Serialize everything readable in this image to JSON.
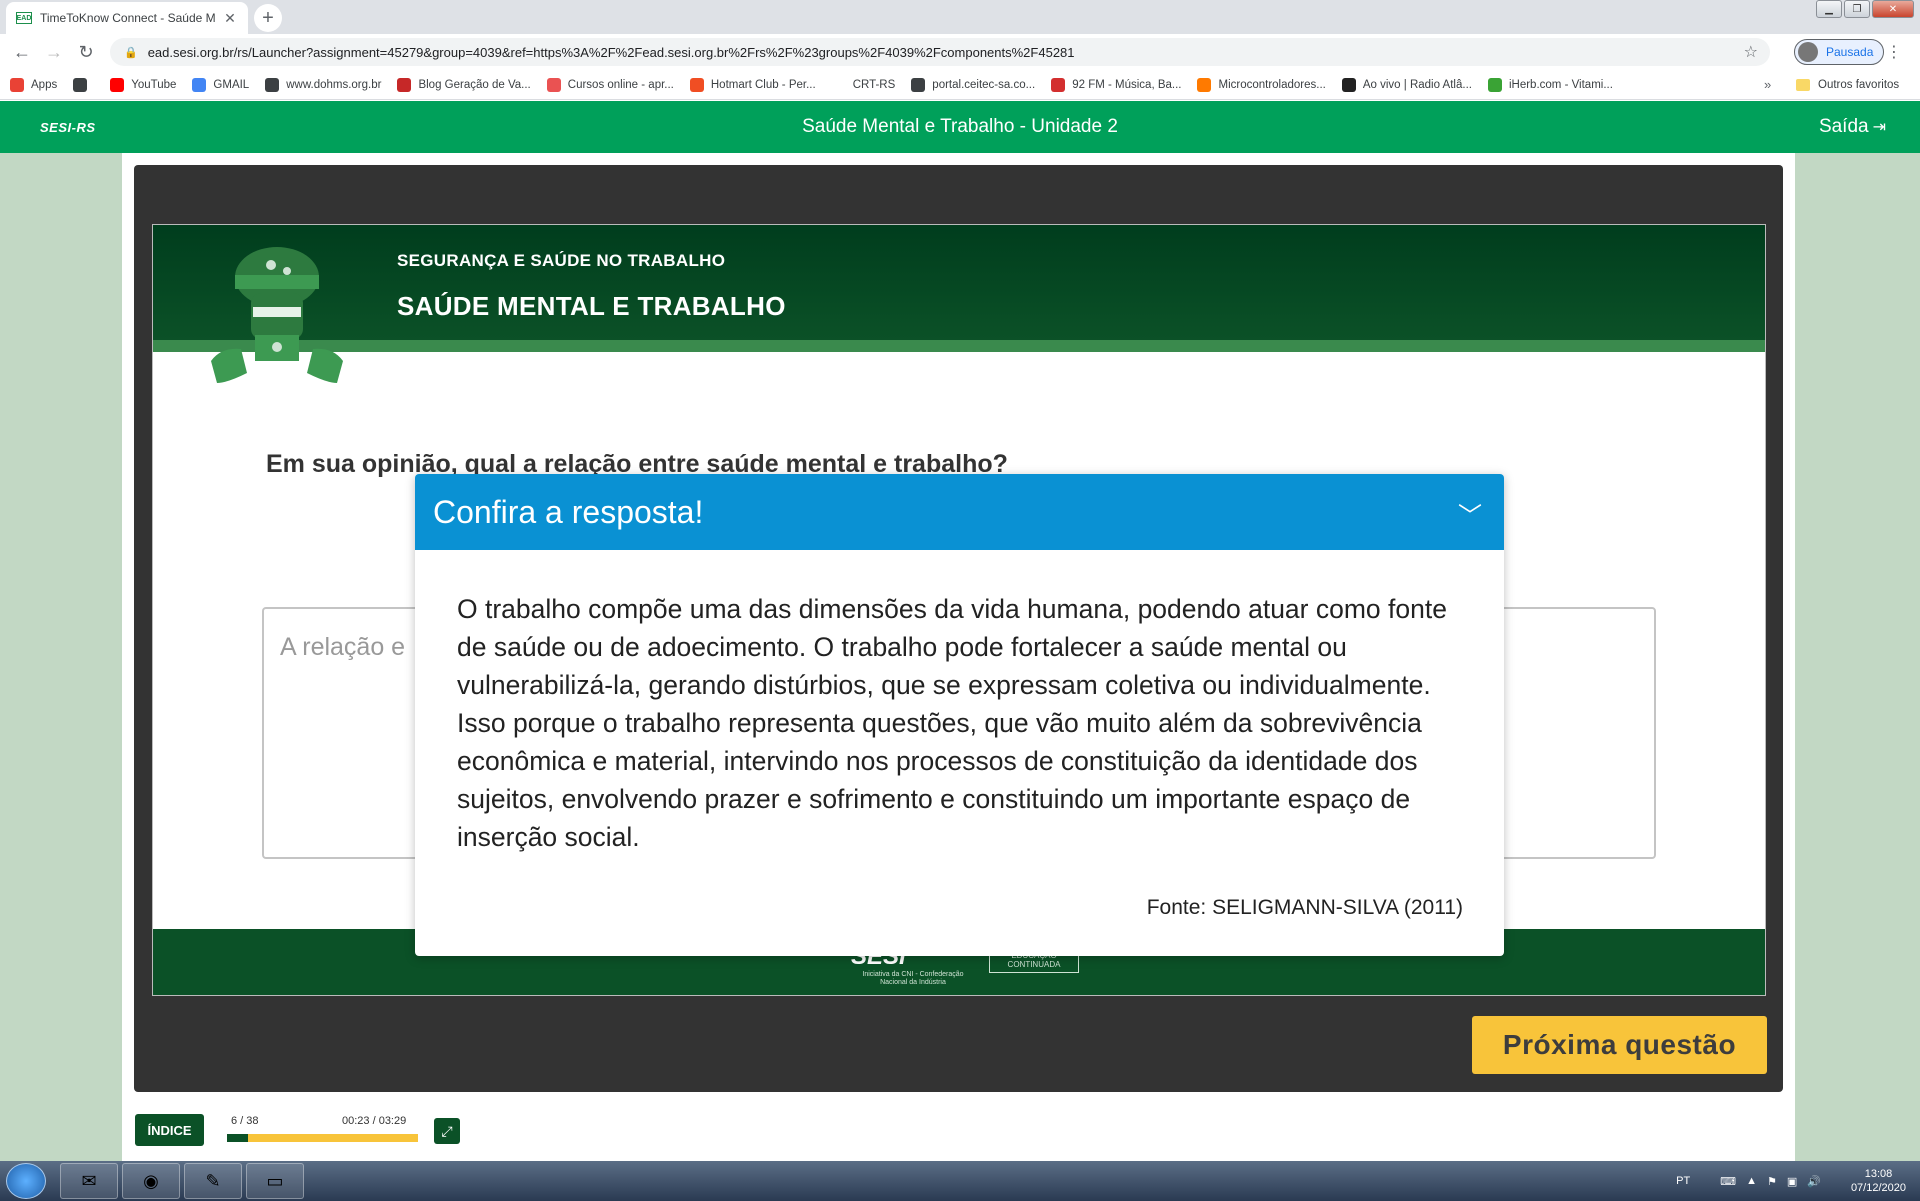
{
  "browser": {
    "tab_title": "TimeToKnow Connect - Saúde M",
    "tab_favicon": "EAD",
    "url": "ead.sesi.org.br/rs/Launcher?assignment=45279&group=4039&ref=https%3A%2F%2Fead.sesi.org.br%2Frs%2F%23groups%2F4039%2Fcomponents%2F45281",
    "profile_label": "Pausada",
    "bookmarks": [
      {
        "label": "Apps",
        "icon": "apps-grid-icon",
        "color": "#e94235"
      },
      {
        "label": "",
        "icon": "globe-icon",
        "color": "#3c4043"
      },
      {
        "label": "YouTube",
        "icon": "youtube-icon",
        "color": "#ff0000"
      },
      {
        "label": "GMAIL",
        "icon": "google-icon",
        "color": "#4285f4"
      },
      {
        "label": "www.dohms.org.br",
        "icon": "globe-icon",
        "color": "#3c4043"
      },
      {
        "label": "Blog Geração de Va...",
        "icon": "blog-icon",
        "color": "#c62828"
      },
      {
        "label": "Cursos online - apr...",
        "icon": "udemy-icon",
        "color": "#ea5252"
      },
      {
        "label": "Hotmart Club - Per...",
        "icon": "hotmart-icon",
        "color": "#f04e23"
      },
      {
        "label": "CRT-RS",
        "icon": "blank-icon",
        "color": "#ffffff"
      },
      {
        "label": "portal.ceitec-sa.co...",
        "icon": "globe-icon",
        "color": "#3c4043"
      },
      {
        "label": "92 FM - Música, Ba...",
        "icon": "radio92-icon",
        "color": "#d32f2f"
      },
      {
        "label": "Microcontroladores...",
        "icon": "blogger-icon",
        "color": "#ff7a00"
      },
      {
        "label": "Ao vivo | Radio Atlâ...",
        "icon": "radio-icon",
        "color": "#222222"
      },
      {
        "label": "iHerb.com - Vitami...",
        "icon": "iherb-icon",
        "color": "#3aa335"
      }
    ],
    "bookmarks_more": "»",
    "other_bookmarks": "Outros favoritos"
  },
  "app": {
    "logo": "SESI-RS",
    "title": "Saúde Mental e Trabalho - Unidade 2",
    "exit_label": "Saída"
  },
  "slide": {
    "banner_subtitle": "SEGURANÇA E SAÚDE NO TRABALHO",
    "banner_title": "SAÚDE MENTAL E TRABALHO",
    "question": "Em sua opinião, qual a relação entre saúde mental e trabalho?",
    "answer_placeholder_visible": "A relação e",
    "footer_logo": "SESI",
    "footer_tag": "Iniciativa da CNI - Confederação Nacional da Indústria",
    "footer_edu": "EDUCAÇÃO CONTINUADA"
  },
  "modal": {
    "title": "Confira a resposta!",
    "body": "O trabalho compõe uma das dimensões da vida humana, podendo atuar como fonte de saúde ou de adoecimento. O trabalho pode fortalecer a saúde mental ou vulnerabilizá-la, gerando distúrbios, que se expressam coletiva ou individualmente. Isso porque o trabalho representa questões, que vão muito além da sobrevivência econômica e material, intervindo nos processos de constituição da identidade dos sujeitos, envolvendo prazer e sofrimento e constituindo um importante espaço de inserção social.",
    "source": "Fonte: SELIGMANN-SILVA (2011)"
  },
  "controls": {
    "next_label": "Próxima questão",
    "index_label": "ÍNDICE",
    "counter": "6 / 38",
    "timer": "00:23 / 03:29",
    "progress_fraction": 0.11
  },
  "taskbar": {
    "lang": "PT",
    "time": "13:08",
    "date": "07/12/2020"
  },
  "colors": {
    "header_green": "#00a05a",
    "dark_green": "#0b5127",
    "modal_blue": "#0a91d3",
    "button_yellow": "#f8c43a"
  }
}
